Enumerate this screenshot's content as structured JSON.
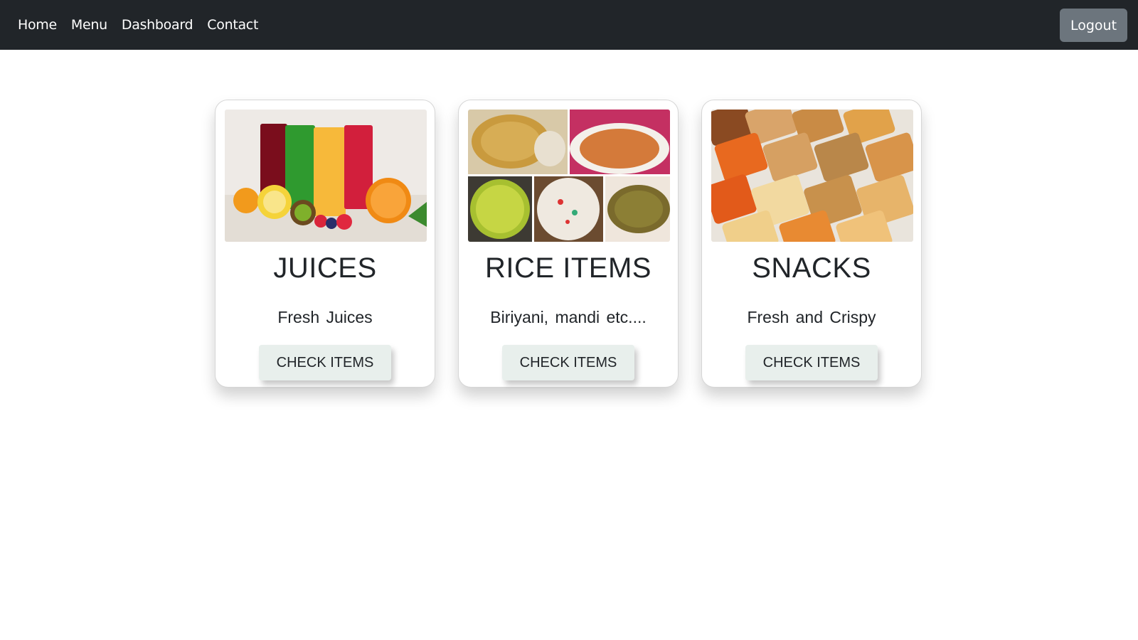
{
  "nav": {
    "links": [
      "Home",
      "Menu",
      "Dashboard",
      "Contact"
    ],
    "logout_label": "Logout"
  },
  "cards": [
    {
      "title": "JUICES",
      "text": "Fresh Juices",
      "button": "CHECK ITEMS",
      "image": "juices-photo"
    },
    {
      "title": "RICE ITEMS",
      "text": "Biriyani, mandi etc....",
      "button": "CHECK ITEMS",
      "image": "rice-items-photo"
    },
    {
      "title": "SNACKS",
      "text": "Fresh and Crispy",
      "button": "CHECK ITEMS",
      "image": "snacks-photo"
    }
  ],
  "colors": {
    "navbar_bg": "#212529",
    "logout_bg": "#6c757d",
    "button_bg": "#e8efec"
  }
}
